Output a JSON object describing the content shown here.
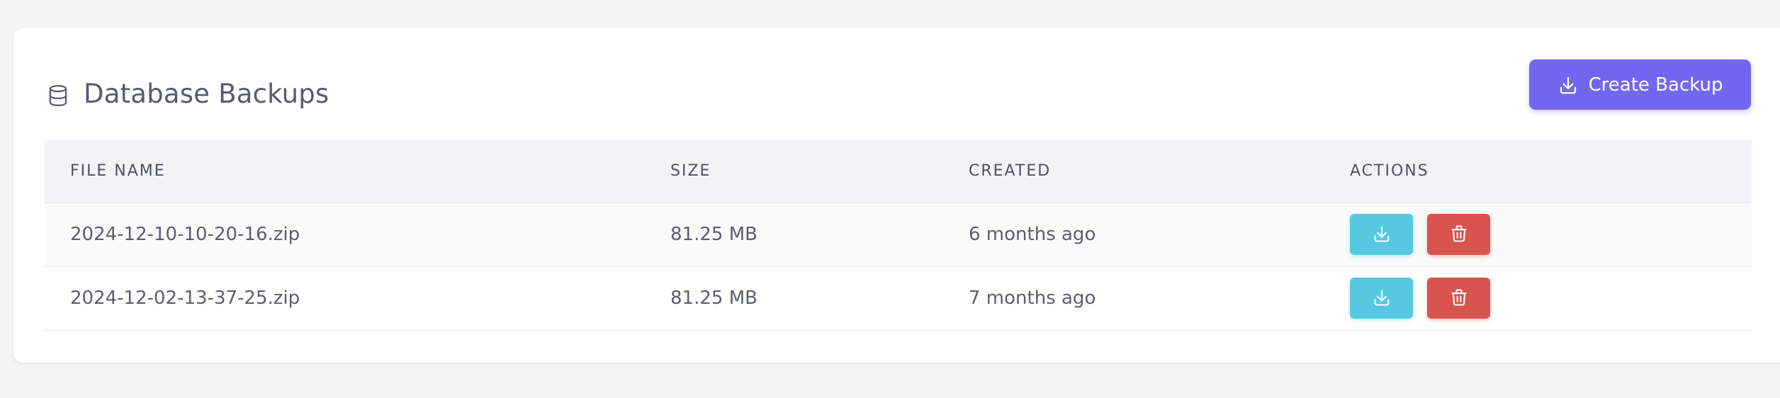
{
  "header": {
    "title": "Database Backups",
    "create_label": "Create Backup",
    "title_icon": "database-icon",
    "create_icon": "download-icon"
  },
  "table": {
    "columns": [
      "FILE NAME",
      "SIZE",
      "CREATED",
      "ACTIONS"
    ],
    "rows": [
      {
        "file_name": "2024-12-10-10-20-16.zip",
        "size": "81.25 MB",
        "created": "6 months ago"
      },
      {
        "file_name": "2024-12-02-13-37-25.zip",
        "size": "81.25 MB",
        "created": "7 months ago"
      }
    ],
    "row_actions": [
      {
        "icon": "download-icon",
        "color": "#56c9e1"
      },
      {
        "icon": "trash-icon",
        "color": "#d9534f"
      }
    ]
  },
  "colors": {
    "primary": "#7367f0",
    "info": "#56c9e1",
    "danger": "#d9534f",
    "text": "#5d5e70",
    "header_bg": "#f3f3f7",
    "page_bg": "#f5f5f6"
  }
}
